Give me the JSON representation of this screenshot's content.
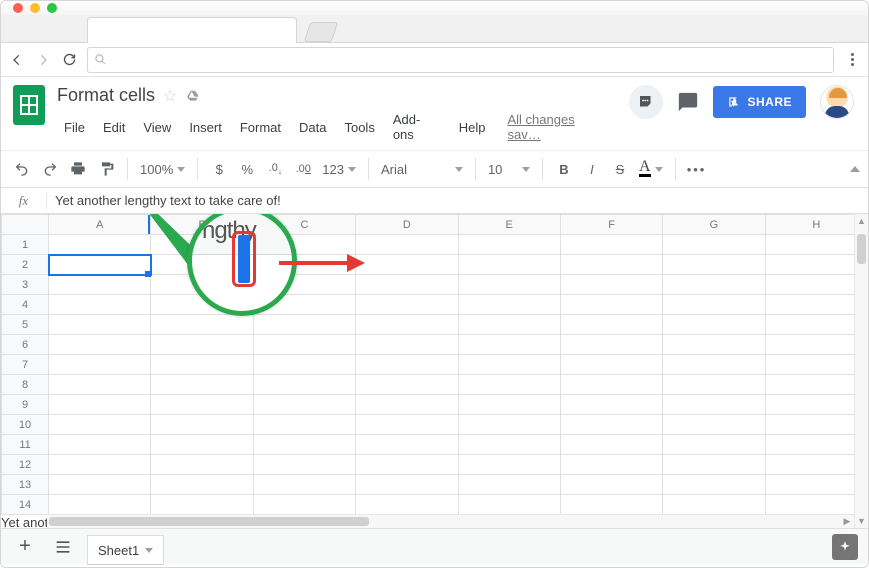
{
  "browser": {
    "tab_title": ""
  },
  "doc": {
    "title": "Format cells",
    "save_status": "All changes sav…",
    "share_label": "SHARE"
  },
  "menus": [
    "File",
    "Edit",
    "View",
    "Insert",
    "Format",
    "Data",
    "Tools",
    "Add-ons",
    "Help"
  ],
  "toolbar": {
    "zoom": "100%",
    "currency": "$",
    "percent": "%",
    "dec_dec": ".0",
    "dec_inc": ".00",
    "numfmt": "123",
    "font": "Arial",
    "font_size": "10",
    "bold": "B",
    "italic": "I",
    "strike": "S",
    "textcolor": "A",
    "more": "•••"
  },
  "formula": {
    "label": "fx",
    "value": "Yet another lengthy text to take care of!"
  },
  "grid": {
    "columns": [
      "A",
      "B",
      "C",
      "D",
      "E",
      "F",
      "G",
      "H"
    ],
    "rows": 14,
    "selected": {
      "row": 2,
      "col": "A"
    },
    "cell_A2_display": "Yet another lengthy text to"
  },
  "sheets": {
    "active": "Sheet1"
  },
  "magnifier_text": "ngthy"
}
